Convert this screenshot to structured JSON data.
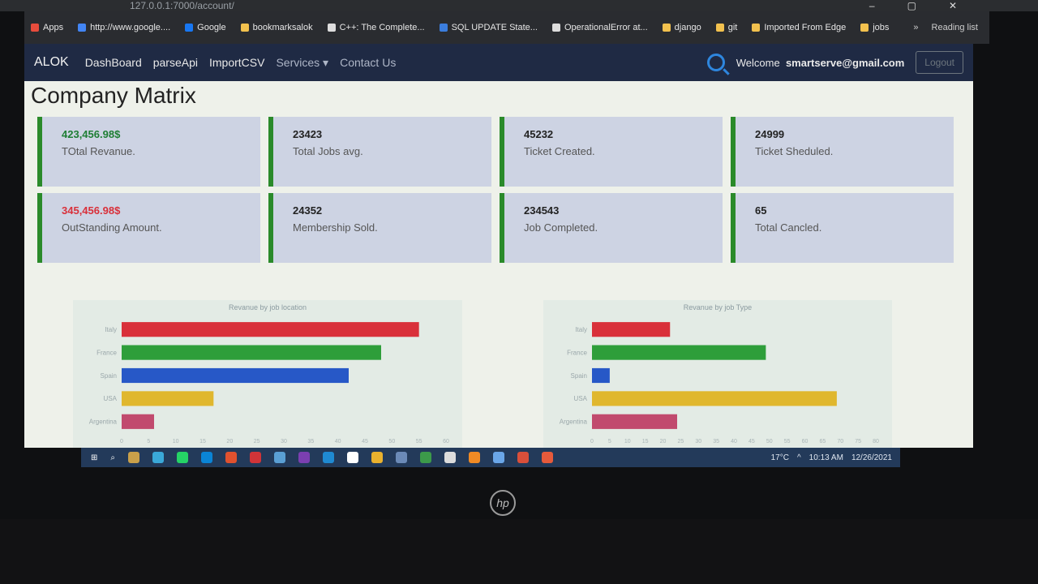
{
  "browser": {
    "url": "127.0.0.1:7000/account/",
    "bookmarks": [
      {
        "label": "Apps",
        "color": "#e74c3c"
      },
      {
        "label": "http://www.google....",
        "color": "#4285f4"
      },
      {
        "label": "Google",
        "color": "#1877f2"
      },
      {
        "label": "bookmarksalok",
        "color": "#f2c14e"
      },
      {
        "label": "C++: The Complete...",
        "color": "#dddddd"
      },
      {
        "label": "SQL UPDATE State...",
        "color": "#3b7ddd"
      },
      {
        "label": "OperationalError at...",
        "color": "#dddddd"
      },
      {
        "label": "django",
        "color": "#f2c14e"
      },
      {
        "label": "git",
        "color": "#f2c14e"
      },
      {
        "label": "Imported From Edge",
        "color": "#f2c14e"
      },
      {
        "label": "jobs",
        "color": "#f2c14e"
      }
    ],
    "overflow": "»",
    "reading_list": "Reading list"
  },
  "navbar": {
    "brand": "ALOK",
    "links": [
      "DashBoard",
      "parseApi",
      "ImportCSV"
    ],
    "services": "Services",
    "contact": "Contact Us",
    "welcome_label": "Welcome",
    "welcome_user": "smartserve@gmail.com",
    "logout": "Logout"
  },
  "page": {
    "title": "Company Matrix"
  },
  "cards": [
    {
      "value": "423,456.98$",
      "label": "TOtal Revanue.",
      "value_color": "green"
    },
    {
      "value": "23423",
      "label": "Total Jobs avg.",
      "value_color": "dark"
    },
    {
      "value": "45232",
      "label": "Ticket Created.",
      "value_color": "dark"
    },
    {
      "value": "24999",
      "label": "Ticket Sheduled.",
      "value_color": "dark"
    },
    {
      "value": "345,456.98$",
      "label": "OutStanding Amount.",
      "value_color": "red"
    },
    {
      "value": "24352",
      "label": "Membership Sold.",
      "value_color": "dark"
    },
    {
      "value": "234543",
      "label": "Job Completed.",
      "value_color": "dark"
    },
    {
      "value": "65",
      "label": "Total Cancled.",
      "value_color": "dark"
    }
  ],
  "chart_data": [
    {
      "type": "bar",
      "orientation": "horizontal",
      "title": "Revanue by job location",
      "categories": [
        "Italy",
        "France",
        "Spain",
        "USA",
        "Argentina"
      ],
      "values": [
        55,
        48,
        42,
        17,
        6
      ],
      "colors": [
        "#d9303a",
        "#2e9e3a",
        "#2758c7",
        "#e0b72e",
        "#c14a6e"
      ],
      "xlim": [
        0,
        60
      ],
      "xticks": [
        0,
        5,
        10,
        15,
        20,
        25,
        30,
        35,
        40,
        45,
        50,
        55,
        60
      ]
    },
    {
      "type": "bar",
      "orientation": "horizontal",
      "title": "Revanue by job Type",
      "categories": [
        "Italy",
        "France",
        "Spain",
        "USA",
        "Argentina"
      ],
      "values": [
        22,
        49,
        5,
        69,
        24
      ],
      "colors": [
        "#d9303a",
        "#2e9e3a",
        "#2758c7",
        "#e0b72e",
        "#c14a6e"
      ],
      "xlim": [
        0,
        80
      ],
      "xticks": [
        0,
        5,
        10,
        15,
        20,
        25,
        30,
        35,
        40,
        45,
        50,
        55,
        60,
        65,
        70,
        75,
        80
      ]
    }
  ],
  "taskbar": {
    "weather": "17°C",
    "time": "10:13 AM",
    "date": "12/26/2021"
  }
}
